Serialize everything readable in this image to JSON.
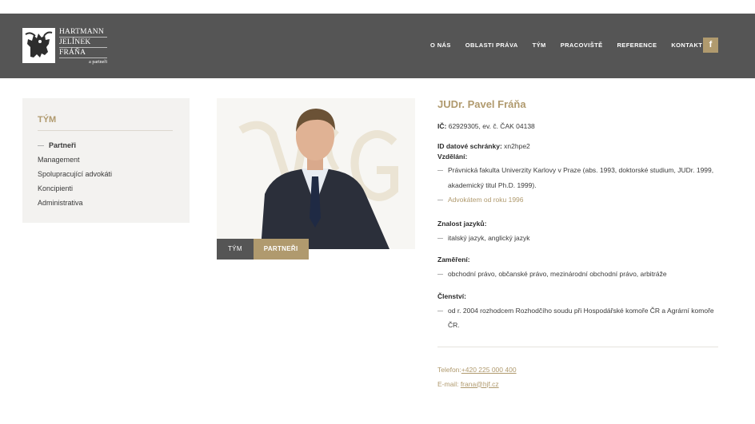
{
  "brand": {
    "lines": [
      "HARTMANN",
      "JELÍNEK",
      "FRÁŇA"
    ],
    "sub": "a partneři"
  },
  "nav": {
    "items": [
      "O NÁS",
      "OBLASTI PRÁVA",
      "TÝM",
      "PRACOVIŠTĚ",
      "REFERENCE",
      "KONTAKT"
    ],
    "facebook": "f"
  },
  "sidebar": {
    "title": "TÝM",
    "items": [
      "Partneři",
      "Management",
      "Spolupracující advokáti",
      "Koncipienti",
      "Administrativa"
    ]
  },
  "breadcrumb": {
    "items": [
      "TÝM",
      "PARTNEŘI"
    ]
  },
  "profile": {
    "name": "JUDr. Pavel Fráňa",
    "ic_label": "IČ:",
    "ic_value": "62929305, ev. č. ČAK 04138",
    "datova_label": "ID datové schránky:",
    "datova_value": "xn2hpe2",
    "education_label": "Vzdělání:",
    "education": [
      "Právnická fakulta Univerzity Karlovy v Praze (abs. 1993, doktorské studium, JUDr. 1999, akademický titul Ph.D. 1999).",
      "Advokátem od roku 1996"
    ],
    "languages_label": "Znalost jazyků:",
    "languages": [
      "italský jazyk, anglický jazyk"
    ],
    "focus_label": "Zaměření:",
    "focus": [
      "obchodní právo, občanské právo, mezinárodní obchodní právo, arbitráže"
    ],
    "membership_label": "Členství:",
    "membership": [
      "od r. 2004 rozhodcem Rozhodčího soudu při Hospodářské komoře ČR a Agrární komoře ČR."
    ],
    "phone_label": "Telefon:",
    "phone": "+420 225 000 400",
    "email_label": "E-mail: ",
    "email": "frana@hjf.cz"
  },
  "colors": {
    "accent": "#b09a6e",
    "header": "#555555",
    "sidebar_bg": "#f3f2f0"
  }
}
